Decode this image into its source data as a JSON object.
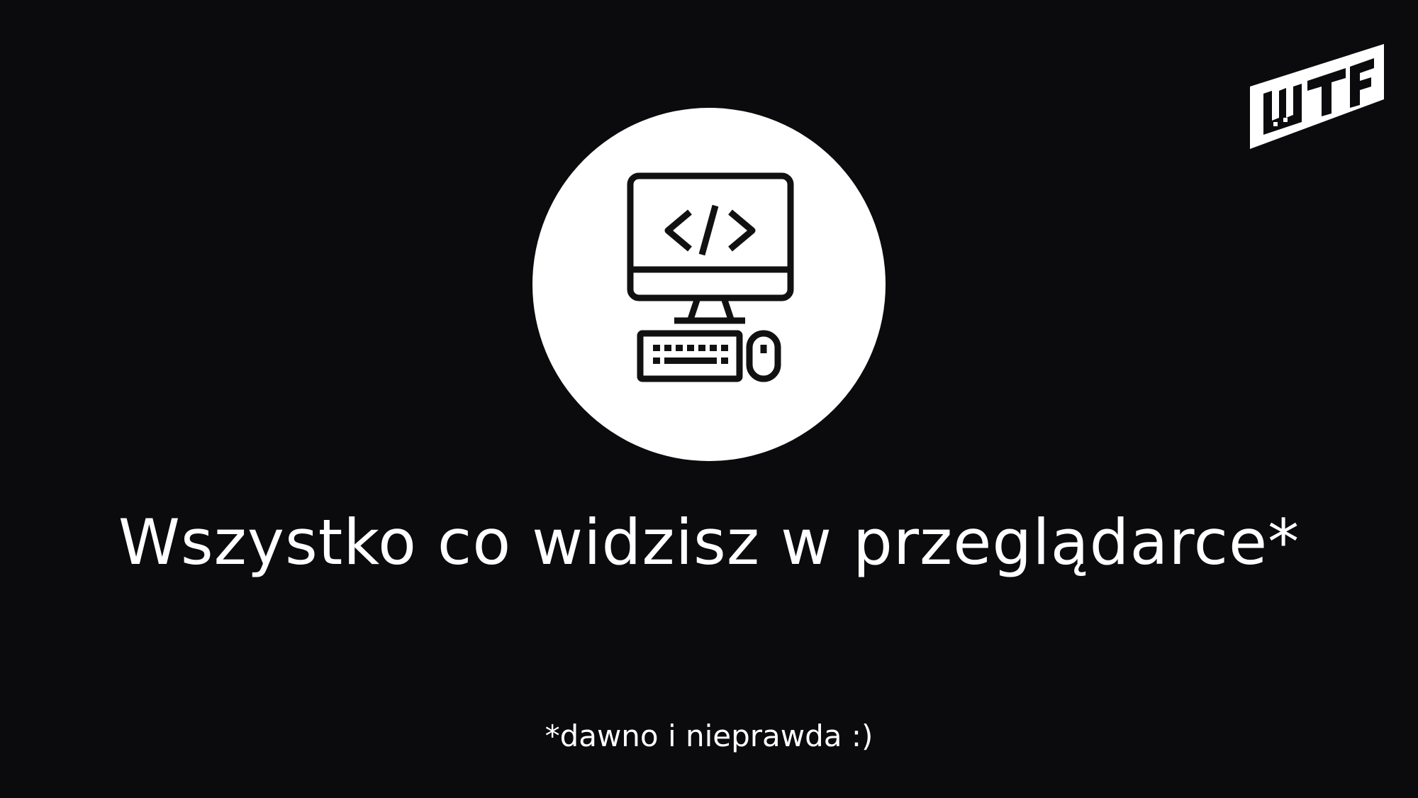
{
  "slide": {
    "logo_text": "WTF",
    "headline": "Wszystko co widzisz w przeglądarce*",
    "footnote": "*dawno i nieprawda :)",
    "icon": "computer-code-icon"
  },
  "colors": {
    "background": "#0b0a0d",
    "foreground": "#ffffff",
    "icon_stroke": "#111111"
  }
}
